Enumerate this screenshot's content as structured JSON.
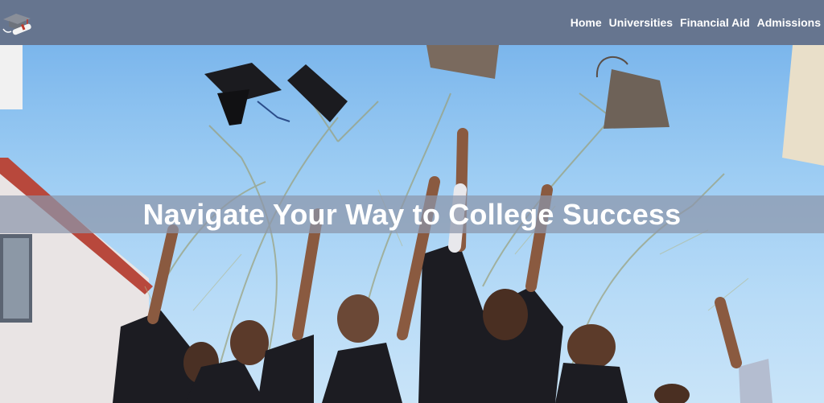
{
  "nav": {
    "logo_icon": "graduation-cap-diploma-icon",
    "links": [
      "Home",
      "Universities",
      "Financial Aid",
      "Admissions"
    ]
  },
  "hero": {
    "headline": "Navigate Your Way to College Success",
    "image_subject": "graduates-tossing-caps-photo"
  },
  "colors": {
    "navbar": "#66758f",
    "banner_overlay": "#8c96aa",
    "text": "#ffffff"
  }
}
